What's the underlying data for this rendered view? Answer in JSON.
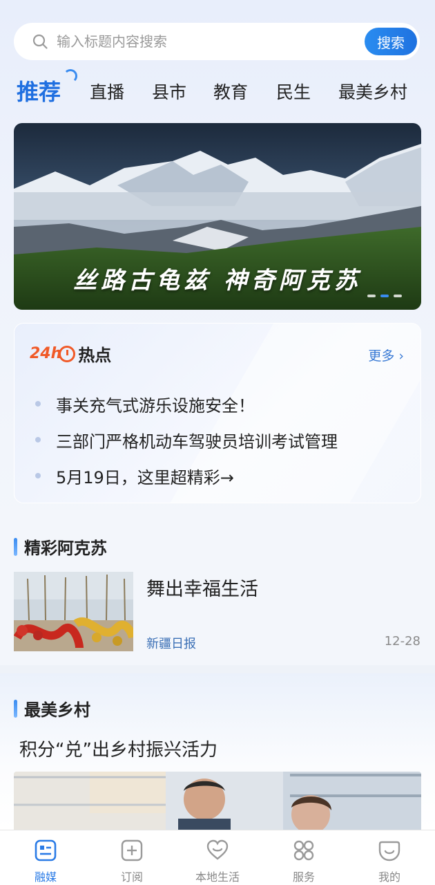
{
  "search": {
    "placeholder": "输入标题内容搜索",
    "button_label": "搜索"
  },
  "tabs": [
    {
      "label": "推荐",
      "active": true
    },
    {
      "label": "直播"
    },
    {
      "label": "县市"
    },
    {
      "label": "教育"
    },
    {
      "label": "民生"
    },
    {
      "label": "最美乡村"
    }
  ],
  "banner": {
    "caption": "丝路古龟兹 神奇阿克苏",
    "dot_count": 3,
    "active_dot": 2
  },
  "hot": {
    "logo_24": "24h",
    "title": "热点",
    "more_label": "更多 ›",
    "items": [
      "事关充气式游乐设施安全！",
      "三部门严格机动车驾驶员培训考试管理",
      "5月19日，这里超精彩→"
    ]
  },
  "section1": {
    "title": "精彩阿克苏",
    "news": {
      "title": "舞出幸福生活",
      "source": "新疆日报",
      "date": "12-28"
    }
  },
  "section2": {
    "title": "最美乡村",
    "article_title": "积分“兑”出乡村振兴活力"
  },
  "bottom_nav": [
    {
      "label": "融媒",
      "icon": "media-icon",
      "active": true
    },
    {
      "label": "订阅",
      "icon": "subscribe-icon"
    },
    {
      "label": "本地生活",
      "icon": "heart-icon"
    },
    {
      "label": "服务",
      "icon": "grid-icon"
    },
    {
      "label": "我的",
      "icon": "profile-icon"
    }
  ],
  "colors": {
    "accent": "#1f6fe0",
    "hot_orange": "#f05a28"
  }
}
